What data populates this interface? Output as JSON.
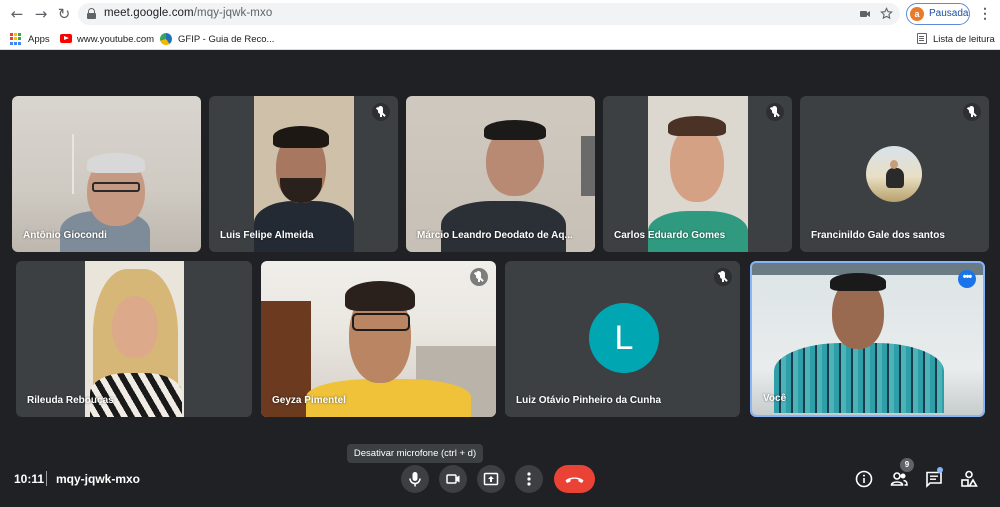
{
  "browser": {
    "url_host": "meet.google.com",
    "url_path": "/mqy-jqwk-mxo",
    "profile_initial": "a",
    "profile_label": "Pausada",
    "bookmarks": {
      "apps": "Apps",
      "youtube": "www.youtube.com",
      "gfip": "GFIP - Guia de Reco...",
      "reading_list": "Lista de leitura"
    }
  },
  "participants": [
    {
      "name": "Antônio Giocondi",
      "muted": false
    },
    {
      "name": "Luis Felipe Almeida",
      "muted": true
    },
    {
      "name": "Márcio Leandro Deodato de Aq...",
      "muted": false
    },
    {
      "name": "Carlos Eduardo Gomes",
      "muted": true
    },
    {
      "name": "Francinildo Gale dos santos",
      "muted": true
    },
    {
      "name": "Rileuda Rebouças",
      "muted": false
    },
    {
      "name": "Geyza Pimentel",
      "muted": true
    },
    {
      "name": "Luiz Otávio Pinheiro da Cunha",
      "muted": true,
      "initial": "L"
    },
    {
      "name": "Você",
      "muted": false
    }
  ],
  "tooltip": "Desativar microfone (ctrl + d)",
  "bottom_bar": {
    "time": "10:11",
    "meeting_code": "mqy-jqwk-mxo",
    "people_count": "9"
  },
  "colors": {
    "background": "#202124",
    "tile": "#3c4043",
    "hangup": "#ea4335",
    "accent": "#1a73e8",
    "letter_avatar": "#00a7b3"
  },
  "icons": {
    "mic": "microphone-icon",
    "camera": "camera-icon",
    "present": "present-screen-icon",
    "more": "more-options-icon",
    "hangup": "hang-up-icon",
    "info": "info-icon",
    "people": "people-icon",
    "chat": "chat-icon",
    "activities": "activities-icon"
  }
}
